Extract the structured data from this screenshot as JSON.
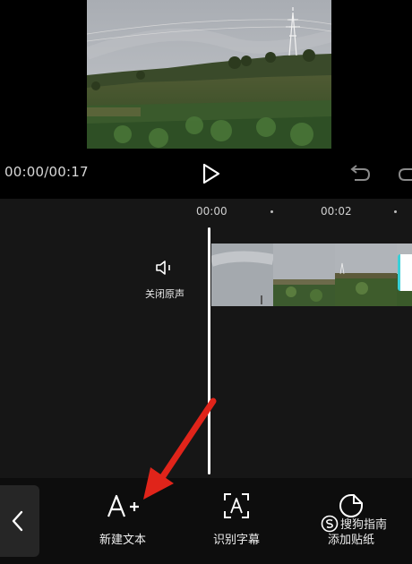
{
  "playback": {
    "timecode": "00:00/00:17",
    "play_icon": "play-icon",
    "undo_icon": "undo-icon",
    "redo_icon": "redo-icon"
  },
  "timeline": {
    "ruler": {
      "marks": [
        "00:00",
        "00:02"
      ]
    },
    "mute": {
      "icon": "speaker-icon",
      "label": "关闭原声"
    },
    "clip_handle_icon": "clip-handle"
  },
  "toolbar": {
    "back_icon": "chevron-left-icon",
    "tools": [
      {
        "label": "新建文本",
        "icon": "add-text-icon"
      },
      {
        "label": "识别字幕",
        "icon": "recognize-subtitle-icon"
      },
      {
        "label": "添加贴纸",
        "icon": "sticker-icon"
      }
    ]
  },
  "annotation": {
    "color": "#e0241a",
    "icon": "red-arrow"
  },
  "watermark": {
    "text": "搜狗指南",
    "icon": "sogou-logo"
  }
}
